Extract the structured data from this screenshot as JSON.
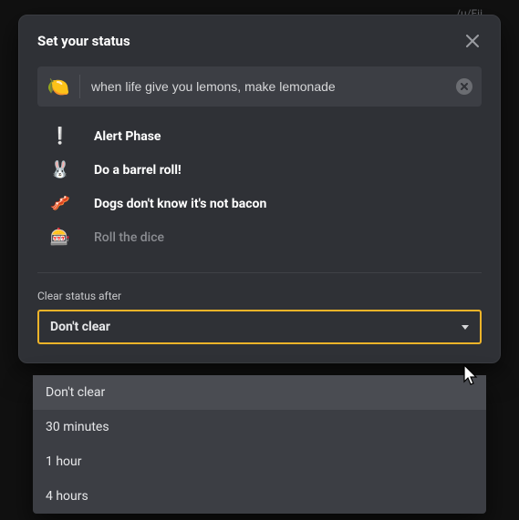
{
  "background": {
    "user_hint": "/u/Fii"
  },
  "modal": {
    "title": "Set your status",
    "emoji": "🍋",
    "status_value": "when life give you lemons, make lemonade",
    "suggestions": [
      {
        "icon": "❕",
        "label": "Alert Phase",
        "muted": false
      },
      {
        "icon": "🐰",
        "label": "Do a barrel roll!",
        "muted": false
      },
      {
        "icon": "🥓",
        "label": "Dogs don't know it's not bacon",
        "muted": false
      },
      {
        "icon": "🎰",
        "label": "Roll the dice",
        "muted": true
      }
    ],
    "clear_after": {
      "label": "Clear status after",
      "selected": "Don't clear",
      "options": [
        "Don't clear",
        "30 minutes",
        "1 hour",
        "4 hours"
      ]
    }
  }
}
